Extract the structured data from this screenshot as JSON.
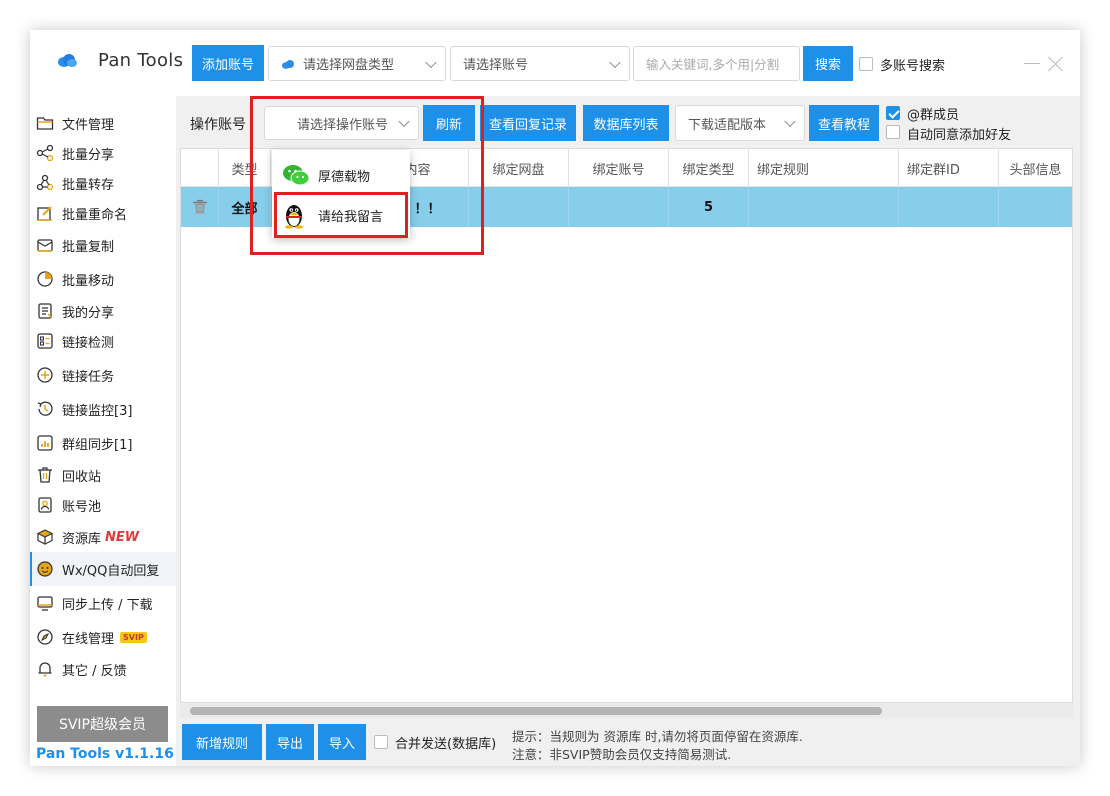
{
  "app": {
    "title": "Pan Tools",
    "version": "Pan Tools v1.1.16"
  },
  "colors": {
    "accent": "#1e90e8",
    "selected_row": "#87ceeb",
    "highlight": "#e02020"
  },
  "toolbar": {
    "add_account": "添加账号",
    "disk_type_placeholder": "请选择网盘类型",
    "account_placeholder": "请选择账号",
    "search_placeholder": "输入关键词,多个用|分割",
    "search": "搜索",
    "multi_account_search": "多账号搜索"
  },
  "sidebar": {
    "items": [
      {
        "label": "文件管理",
        "icon": "folder-icon"
      },
      {
        "label": "批量分享",
        "icon": "share-icon"
      },
      {
        "label": "批量转存",
        "icon": "transfer-icon"
      },
      {
        "label": "批量重命名",
        "icon": "rename-icon"
      },
      {
        "label": "批量复制",
        "icon": "copy-icon"
      },
      {
        "label": "批量移动",
        "icon": "move-icon"
      },
      {
        "label": "我的分享",
        "icon": "my-share-icon"
      },
      {
        "label": "链接检测",
        "icon": "link-check-icon"
      },
      {
        "label": "链接任务",
        "icon": "link-task-icon"
      },
      {
        "label": "链接监控[3]",
        "icon": "link-monitor-icon"
      },
      {
        "label": "群组同步[1]",
        "icon": "group-sync-icon"
      },
      {
        "label": "回收站",
        "icon": "trash-icon"
      },
      {
        "label": "账号池",
        "icon": "account-pool-icon"
      },
      {
        "label": "资源库",
        "icon": "resource-icon",
        "badge": "NEW"
      },
      {
        "label": "Wx/QQ自动回复",
        "icon": "auto-reply-icon"
      },
      {
        "label": "同步上传 / 下载",
        "icon": "sync-icon"
      },
      {
        "label": "在线管理",
        "icon": "online-icon",
        "badge": "SVIP"
      },
      {
        "label": "其它 / 反馈",
        "icon": "bell-icon"
      }
    ],
    "svip_button": "SVIP超级会员"
  },
  "controls": {
    "operate_account_label": "操作账号",
    "operate_account_placeholder": "请选择操作账号",
    "refresh": "刷新",
    "view_reply_log": "查看回复记录",
    "db_list": "数据库列表",
    "download_version": "下载适配版本",
    "view_tutorial": "查看教程",
    "at_members": "@群成员",
    "auto_add_friend": "自动同意添加好友"
  },
  "dropdown": {
    "items": [
      {
        "label": "厚德载物",
        "icon": "wechat-icon"
      },
      {
        "label": "请给我留言",
        "icon": "qq-icon"
      }
    ]
  },
  "table": {
    "headers": [
      "类型",
      "内容",
      "绑定网盘",
      "绑定账号",
      "绑定类型",
      "绑定规则",
      "绑定群ID",
      "头部信息"
    ],
    "row": {
      "type": "全部",
      "content": "！！",
      "bind_type": "5"
    }
  },
  "footer": {
    "new_rule": "新增规则",
    "export": "导出",
    "import": "导入",
    "merge_send": "合并发送(数据库)",
    "hint1": "提示：当规则为 资源库 时,请勿将页面停留在资源库.",
    "hint2": "注意：非SVIP赞助会员仅支持简易测试."
  }
}
